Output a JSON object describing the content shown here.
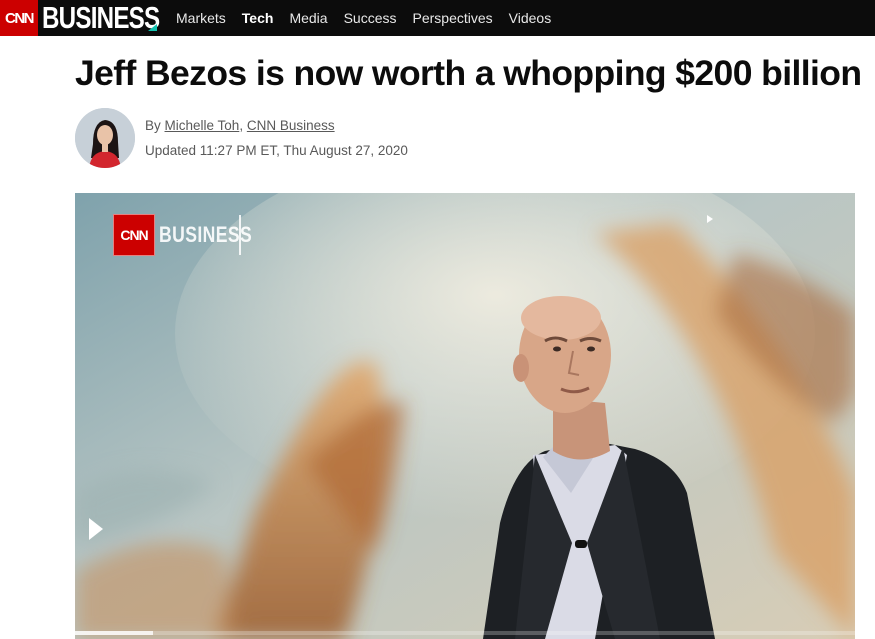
{
  "header": {
    "logo_cnn": "CNN",
    "logo_business": "BUSINESS",
    "nav": [
      {
        "label": "Markets",
        "active": false
      },
      {
        "label": "Tech",
        "active": true
      },
      {
        "label": "Media",
        "active": false
      },
      {
        "label": "Success",
        "active": false
      },
      {
        "label": "Perspectives",
        "active": false
      },
      {
        "label": "Videos",
        "active": false
      }
    ]
  },
  "article": {
    "headline": "Jeff Bezos is now worth a whopping $200 billion",
    "byline_prefix": "By ",
    "author": "Michelle Toh",
    "byline_sep": ", ",
    "outlet": "CNN Business",
    "updated": "Updated 11:27 PM ET, Thu August 27, 2020"
  },
  "video": {
    "watermark_cnn": "CNN",
    "watermark_business": "BUSINESS",
    "progress_fraction": 0.1
  },
  "colors": {
    "brand_red": "#cc0000",
    "nav_bg": "#0c0c0c",
    "accent_teal": "#14c3b0"
  }
}
